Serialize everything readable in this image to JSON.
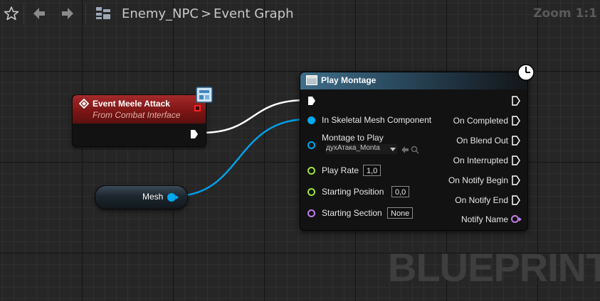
{
  "toolbar": {
    "breadcrumb_graph": "Enemy_NPC",
    "breadcrumb_separator": ">",
    "breadcrumb_page": "Event Graph",
    "zoom_label": "Zoom 1:1"
  },
  "watermark": "BLUEPRINT",
  "event_node": {
    "title": "Event Meele Attack",
    "subtitle": "From Combat Interface"
  },
  "variable_node": {
    "label": "Mesh"
  },
  "play_montage": {
    "title": "Play Montage",
    "inputs": {
      "skeletal_mesh": "In Skeletal Mesh Component",
      "montage": "Montage to Play",
      "montage_value": "духАтака_Monta",
      "play_rate": "Play Rate",
      "play_rate_value": "1,0",
      "starting_position": "Starting Position",
      "starting_position_value": "0,0",
      "starting_section": "Starting Section",
      "starting_section_value": "None"
    },
    "outputs": {
      "on_completed": "On Completed",
      "on_blend_out": "On Blend Out",
      "on_interrupted": "On Interrupted",
      "on_notify_begin": "On Notify Begin",
      "on_notify_end": "On Notify End",
      "notify_name": "Notify Name"
    }
  },
  "colors": {
    "exec_wire": "#ffffff",
    "object_pin": "#00a8f0",
    "float_pin": "#9ee33b",
    "name_pin": "#c27de8",
    "event_header": "#8e1e1e",
    "function_header": "#3f6e8a"
  }
}
